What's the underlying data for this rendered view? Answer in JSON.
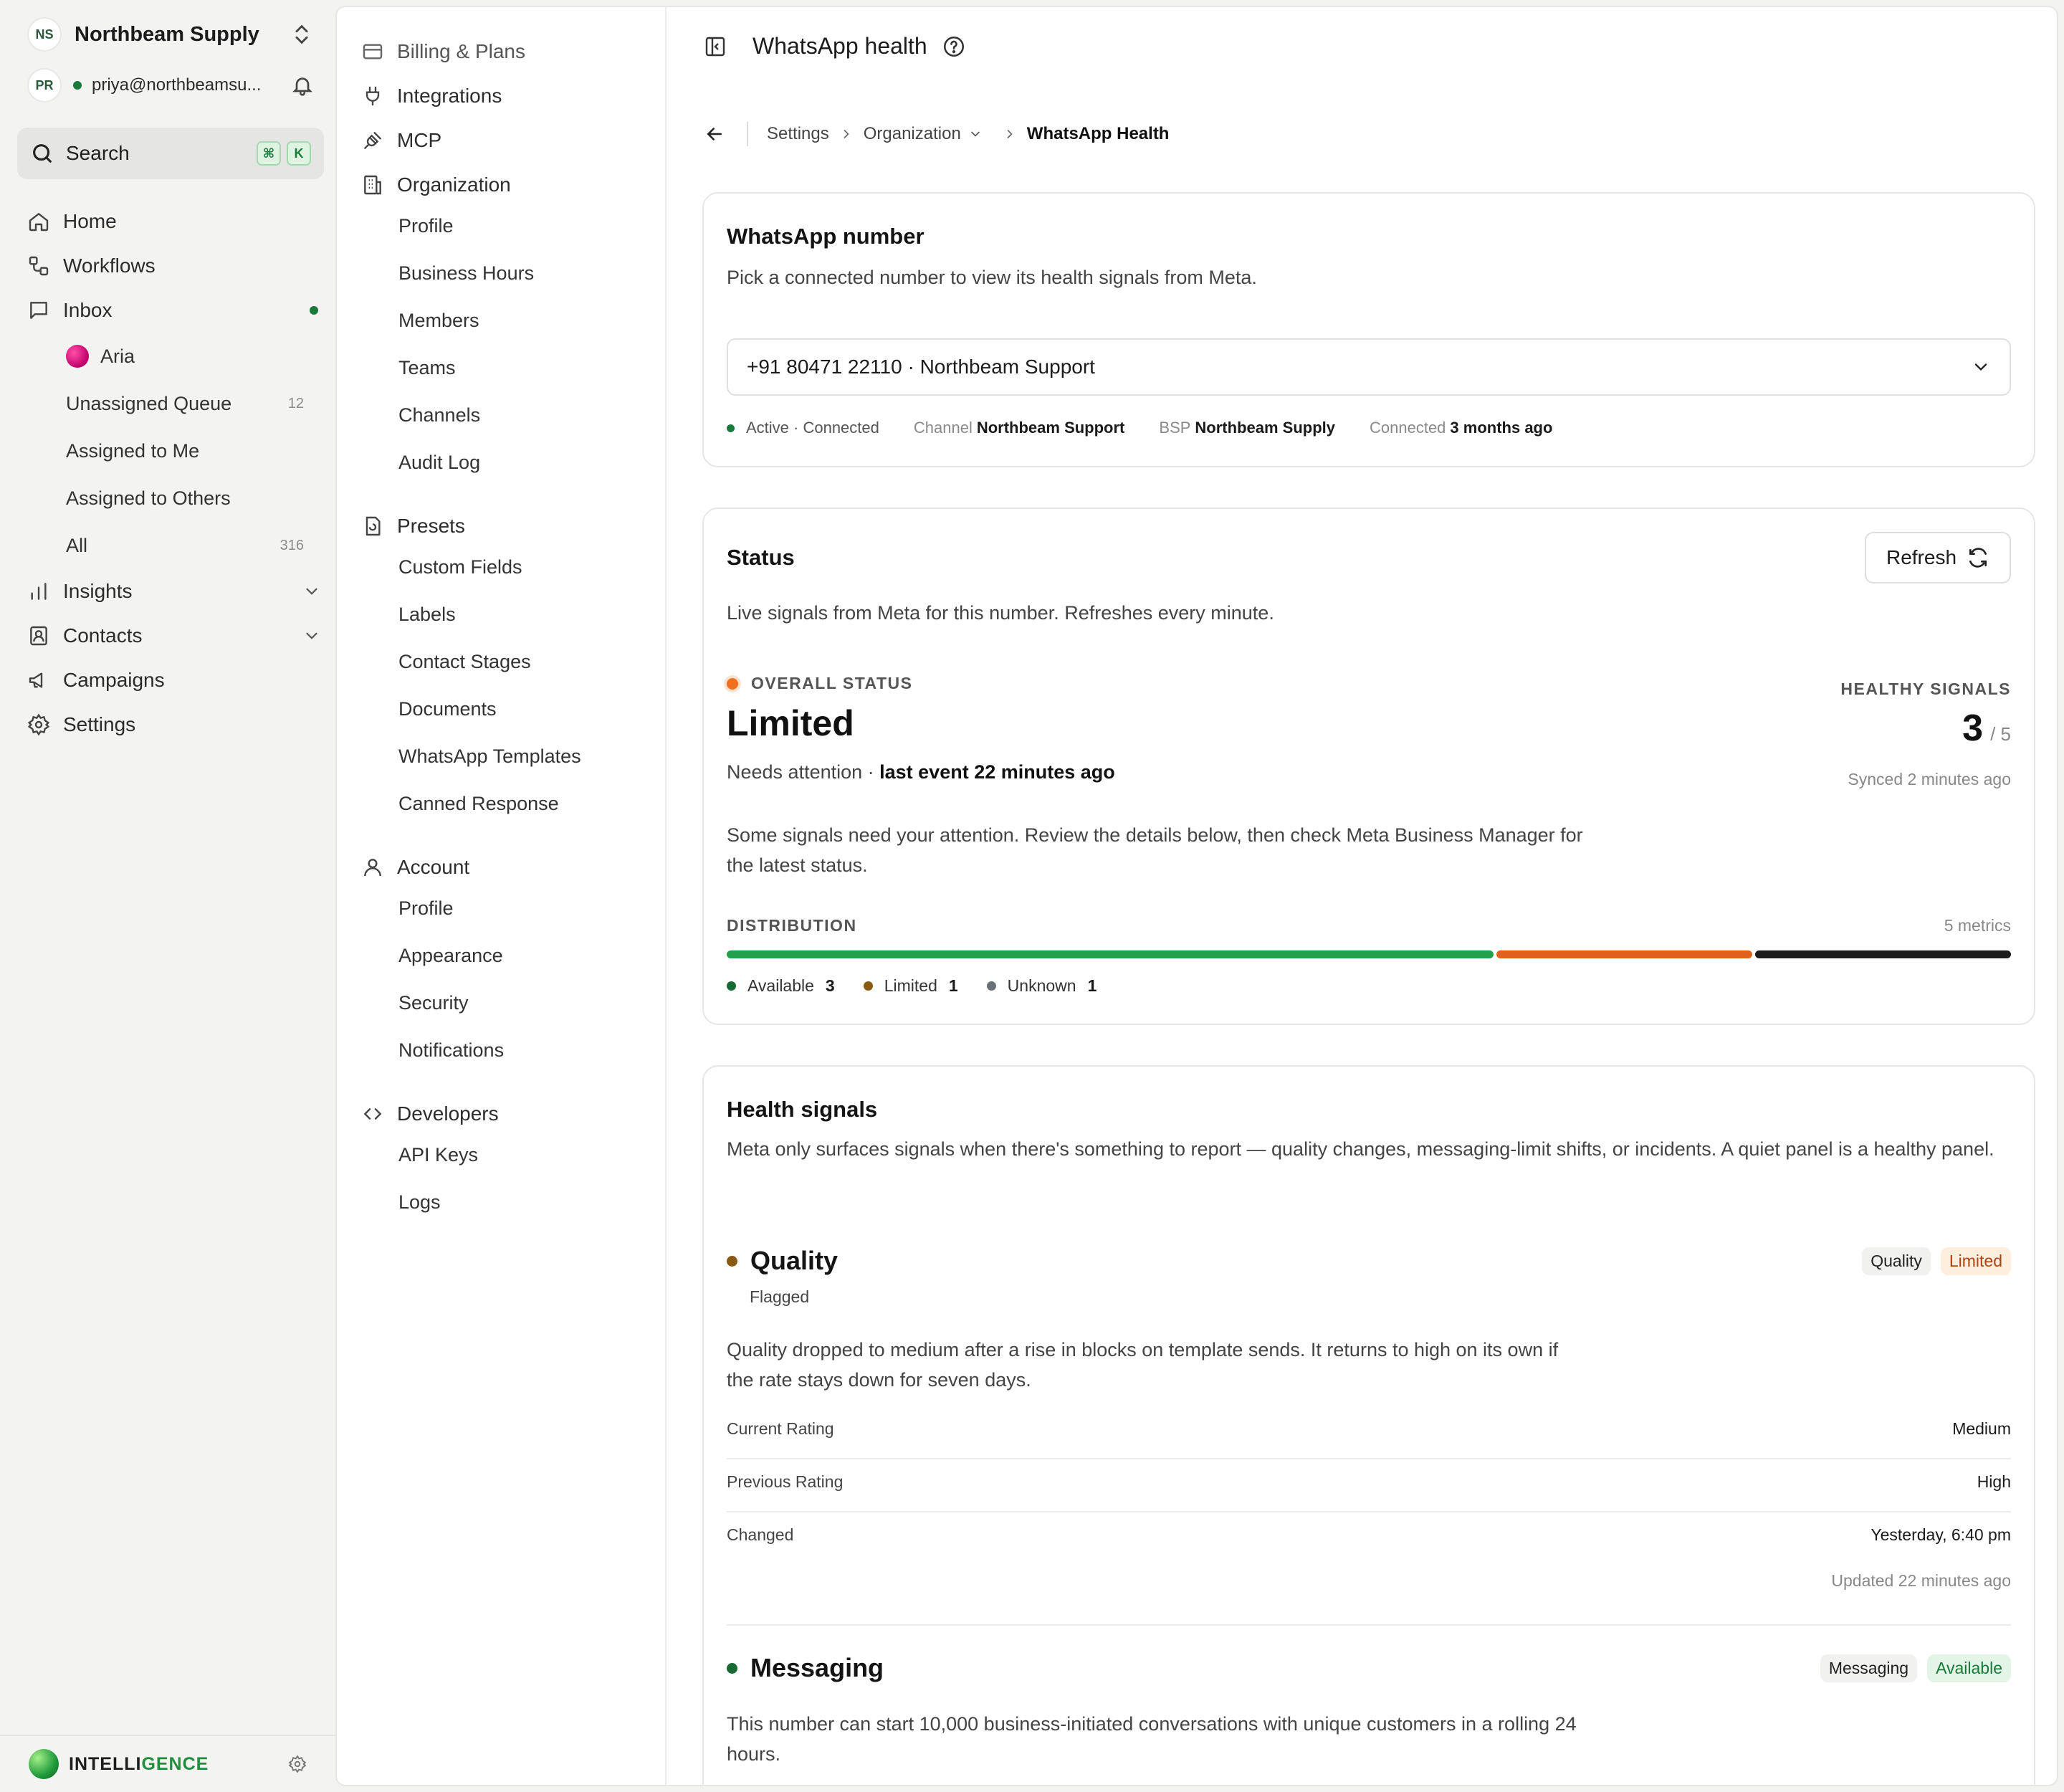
{
  "sidebar": {
    "org_initials": "NS",
    "org_name": "Northbeam Supply",
    "user_initials": "PR",
    "user_email": "priya@northbeamsu...",
    "search_label": "Search",
    "kbd": [
      "⌘",
      "K"
    ],
    "nav": {
      "home": "Home",
      "workflows": "Workflows",
      "inbox": "Inbox",
      "aria": "Aria",
      "unassigned": "Unassigned Queue",
      "unassigned_count": "12",
      "assigned_me": "Assigned to Me",
      "assigned_others": "Assigned to Others",
      "all": "All",
      "all_count": "316",
      "insights": "Insights",
      "contacts": "Contacts",
      "campaigns": "Campaigns",
      "settings": "Settings"
    },
    "brand": {
      "pre": "INTELLI",
      "post": "GENCE"
    }
  },
  "settings_nav": {
    "billing": "Billing & Plans",
    "integrations": "Integrations",
    "mcp": "MCP",
    "organization": "Organization",
    "org_items": [
      "Profile",
      "Business Hours",
      "Members",
      "Teams",
      "Channels",
      "Audit Log"
    ],
    "presets": "Presets",
    "preset_items": [
      "Custom Fields",
      "Labels",
      "Contact Stages",
      "Documents",
      "WhatsApp Templates",
      "Canned Response"
    ],
    "account": "Account",
    "account_items": [
      "Profile",
      "Appearance",
      "Security",
      "Notifications"
    ],
    "developers": "Developers",
    "developer_items": [
      "API Keys",
      "Logs"
    ]
  },
  "header": {
    "title": "WhatsApp health"
  },
  "breadcrumb": {
    "settings": "Settings",
    "organization": "Organization",
    "current": "WhatsApp Health"
  },
  "number_card": {
    "title": "WhatsApp number",
    "description": "Pick a connected number to view its health signals from Meta.",
    "selected": "+91 80471 22110 · Northbeam Support",
    "state": "Active · Connected",
    "channel_label": "Channel",
    "channel_value": "Northbeam Support",
    "bsp_label": "BSP",
    "bsp_value": "Northbeam Supply",
    "connected_label": "Connected",
    "connected_value": "3 months ago"
  },
  "status_card": {
    "title": "Status",
    "refresh_label": "Refresh",
    "description": "Live signals from Meta for this number. Refreshes every minute.",
    "overall_label": "OVERALL STATUS",
    "overall_value": "Limited",
    "needs_attention": "Needs attention ·",
    "last_event": "last event 22 minutes ago",
    "healthy_label": "HEALTHY SIGNALS",
    "healthy_value": "3",
    "healthy_total": "/ 5",
    "synced": "Synced 2 minutes ago",
    "note": "Some signals need your attention. Review the details below, then check Meta Business Manager for the latest status.",
    "distribution_label": "DISTRIBUTION",
    "metrics_label": "5 metrics",
    "distribution": [
      {
        "label": "Available",
        "value": 3,
        "color": "#22a04b"
      },
      {
        "label": "Limited",
        "value": 1,
        "color": "#e0611e"
      },
      {
        "label": "Unknown",
        "value": 1,
        "color": "#1c1c1c"
      }
    ],
    "legend_dot_colors": [
      "#186a35",
      "#8a5a12",
      "#6b6f76"
    ]
  },
  "signals_card": {
    "title": "Health signals",
    "description": "Meta only surfaces signals when there's something to report — quality changes, messaging-limit shifts, or incidents. A quiet panel is a healthy panel.",
    "quality": {
      "title": "Quality",
      "subtitle": "Flagged",
      "tag1": "Quality",
      "tag2": "Limited",
      "body": "Quality dropped to medium after a rise in blocks on template sends. It returns to high on its own if the rate stays down for seven days.",
      "rows": [
        {
          "k": "Current Rating",
          "v": "Medium"
        },
        {
          "k": "Previous Rating",
          "v": "High"
        },
        {
          "k": "Changed",
          "v": "Yesterday, 6:40 pm"
        }
      ],
      "updated": "Updated 22 minutes ago"
    },
    "messaging": {
      "title": "Messaging",
      "tag1": "Messaging",
      "tag2": "Available",
      "body": "This number can start 10,000 business-initiated conversations with unique customers in a rolling 24 hours."
    }
  },
  "colors": {
    "accent_green": "#1a7a3c",
    "warning_orange": "#f0701e",
    "limited_brown": "#8a5a12"
  }
}
